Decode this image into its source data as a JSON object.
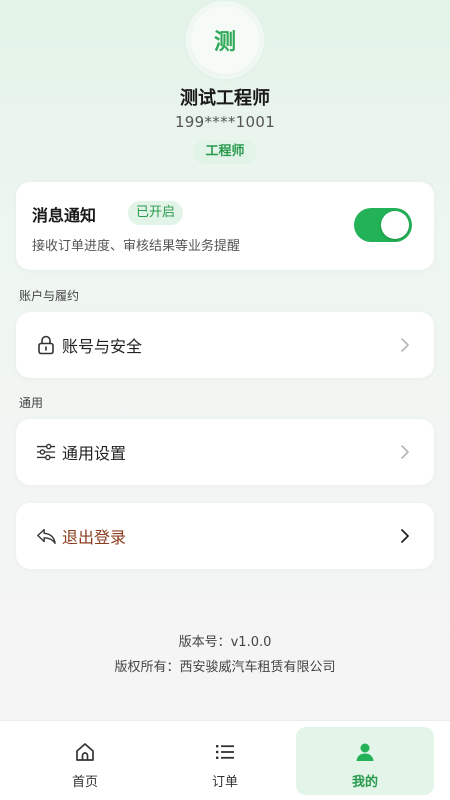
{
  "profile": {
    "avatar_char": "测",
    "name": "测试工程师",
    "phone": "199****1001",
    "role": "工程师"
  },
  "notification": {
    "title": "消息通知",
    "status": "已开启",
    "description": "接收订单进度、审核结果等业务提醒",
    "enabled": true
  },
  "sections": {
    "account": {
      "label": "账户与履约",
      "item": {
        "label": "账号与安全",
        "icon": "lock-icon"
      }
    },
    "general": {
      "label": "通用",
      "item": {
        "label": "通用设置",
        "icon": "sliders-icon"
      }
    }
  },
  "logout": {
    "label": "退出登录",
    "icon": "back-arrow-icon"
  },
  "footer": {
    "version": "版本号：v1.0.0",
    "copyright": "版权所有：西安骏威汽车租赁有限公司"
  },
  "tabs": [
    {
      "label": "首页",
      "icon": "home-icon",
      "active": false
    },
    {
      "label": "订单",
      "icon": "list-icon",
      "active": false
    },
    {
      "label": "我的",
      "icon": "user-icon",
      "active": true
    }
  ],
  "colors": {
    "accent": "#23b257",
    "accent_text": "#2a9a4e",
    "badge_bg": "#e2f3e7",
    "logout_text": "#8a3c1c"
  }
}
